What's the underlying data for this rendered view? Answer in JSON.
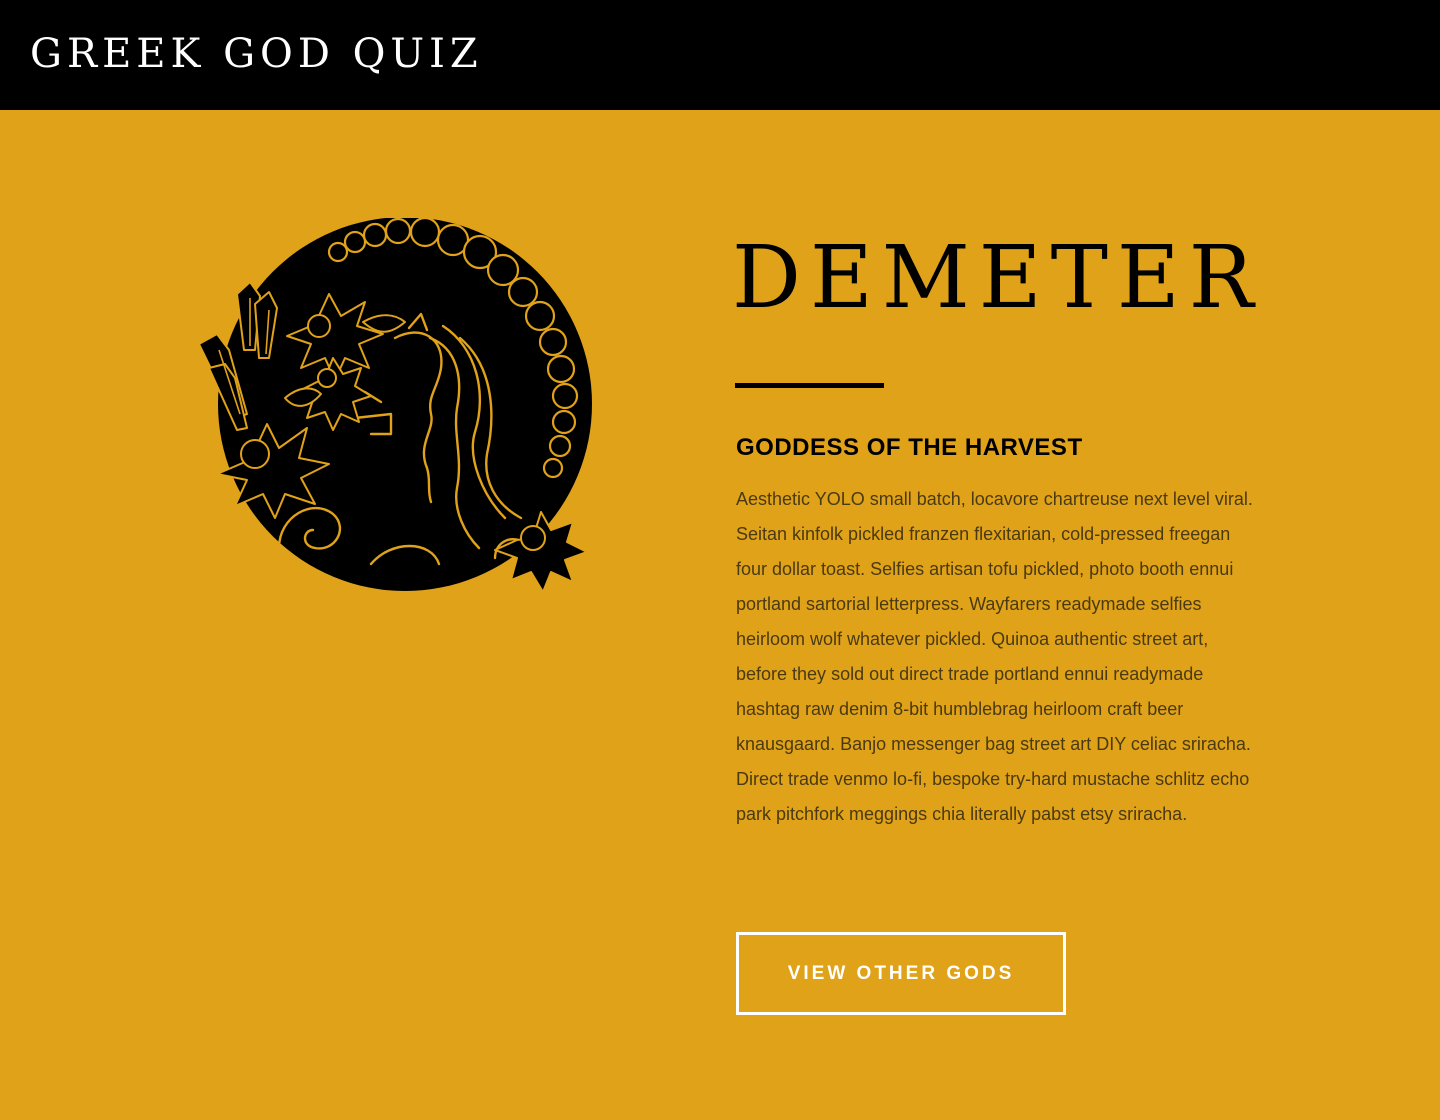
{
  "header": {
    "title": "GREEK GOD QUIZ"
  },
  "result": {
    "emblem_icon": "demeter-emblem-icon",
    "name": "DEMETER",
    "subtitle": "GODDESS OF THE HARVEST",
    "description": "Aesthetic YOLO small batch, locavore chartreuse next level viral. Seitan kinfolk pickled franzen flexitarian, cold-pressed freegan four dollar toast. Selfies artisan tofu pickled, photo booth ennui portland sartorial letterpress. Wayfarers readymade selfies heirloom wolf whatever pickled. Quinoa authentic street art, before they sold out direct trade portland ennui readymade hashtag raw denim 8-bit humblebrag heirloom craft beer knausgaard. Banjo messenger bag street art DIY celiac sriracha. Direct trade venmo lo-fi, bespoke try-hard mustache schlitz echo park pitchfork meggings chia literally pabst etsy sriracha.",
    "button_label": "VIEW OTHER GODS"
  },
  "colors": {
    "background": "#E0A218",
    "header_bg": "#000000",
    "text": "#000000",
    "body_text": "#4a3a12",
    "button_border": "#ffffff"
  }
}
